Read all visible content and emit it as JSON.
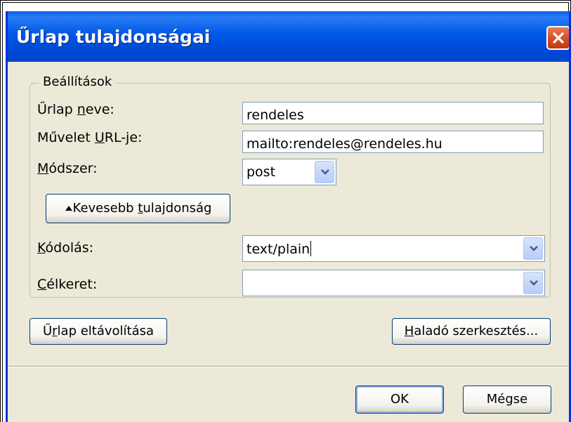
{
  "dialog": {
    "title": "Űrlap tulajdonságai"
  },
  "settings": {
    "legend": "Beállítások",
    "form_name": {
      "label_pre": "Űrlap ",
      "label_ul": "n",
      "label_post": "eve:",
      "value": "rendeles"
    },
    "action_url": {
      "label_pre": "Művelet ",
      "label_ul": "U",
      "label_post": "RL-je:",
      "value": "mailto:rendeles@rendeles.hu"
    },
    "method": {
      "label_pre": "",
      "label_ul": "M",
      "label_post": "ódszer:",
      "value": "post"
    },
    "less_props": {
      "pre": "Kevesebb ",
      "ul": "t",
      "post": "ulajdonság"
    },
    "encoding": {
      "label_pre": "",
      "label_ul": "K",
      "label_post": "ódolás:",
      "value": "text/plain"
    },
    "target": {
      "label_pre": "",
      "label_ul": "C",
      "label_post": "élkeret:",
      "value": ""
    }
  },
  "buttons": {
    "remove_form": {
      "pre": "Ű",
      "ul": "r",
      "post": "lap eltávolítása"
    },
    "advanced_edit": {
      "pre": "",
      "ul": "H",
      "post": "aladó szerkesztés..."
    },
    "ok": "OK",
    "cancel": "Mégse"
  },
  "colors": {
    "titlebar": "#0058e6",
    "dialog_bg": "#ece9d8",
    "close_button": "#d34a22",
    "input_border": "#7f9db9"
  },
  "icons": [
    "close-icon",
    "chevron-down-icon",
    "triangle-up-icon"
  ]
}
